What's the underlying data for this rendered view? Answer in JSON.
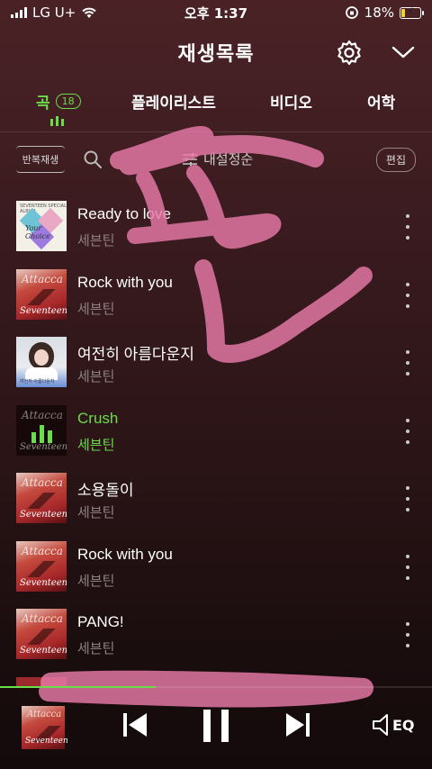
{
  "status_bar": {
    "carrier": "LG U+",
    "time": "오후 1:37",
    "battery": "18%",
    "battery_level": 0.18
  },
  "header": {
    "title": "재생목록",
    "settings_icon": "gear-icon",
    "collapse_icon": "chevron-down-icon"
  },
  "tabs": {
    "songs": {
      "label": "곡",
      "count": "18"
    },
    "playlist": {
      "label": "플레이리스트"
    },
    "video": {
      "label": "비디오"
    },
    "study": {
      "label": "어학"
    }
  },
  "toolbar": {
    "repeat_label": "반복재생",
    "sort_label": "내설정순",
    "edit_label": "편집"
  },
  "songs": [
    {
      "title": "Ready to love",
      "artist": "세븐틴",
      "art": "ready"
    },
    {
      "title": "Rock with you",
      "artist": "세븐틴",
      "art": "attacca"
    },
    {
      "title": "여전히 아름다운지",
      "artist": "세븐틴",
      "art": "iu"
    },
    {
      "title": "Crush",
      "artist": "세븐틴",
      "art": "attacca",
      "playing": true
    },
    {
      "title": "소용돌이",
      "artist": "세븐틴",
      "art": "attacca"
    },
    {
      "title": "Rock with you",
      "artist": "세븐틴",
      "art": "attacca"
    },
    {
      "title": "PANG!",
      "artist": "세븐틴",
      "art": "attacca"
    }
  ],
  "album_art_text": {
    "attacca_top": "Attacca",
    "attacca_bottom": "Seventeen",
    "ready_top": "SEVENTEEN SPECIAL ALBUM",
    "ready_mid": "Your Choice",
    "iu_caption": "여전히 아름다운지"
  },
  "player": {
    "progress": 0.36,
    "eq_label": "EQ"
  },
  "colors": {
    "accent": "#6bdc4a",
    "scribble": "#e87aa8"
  }
}
